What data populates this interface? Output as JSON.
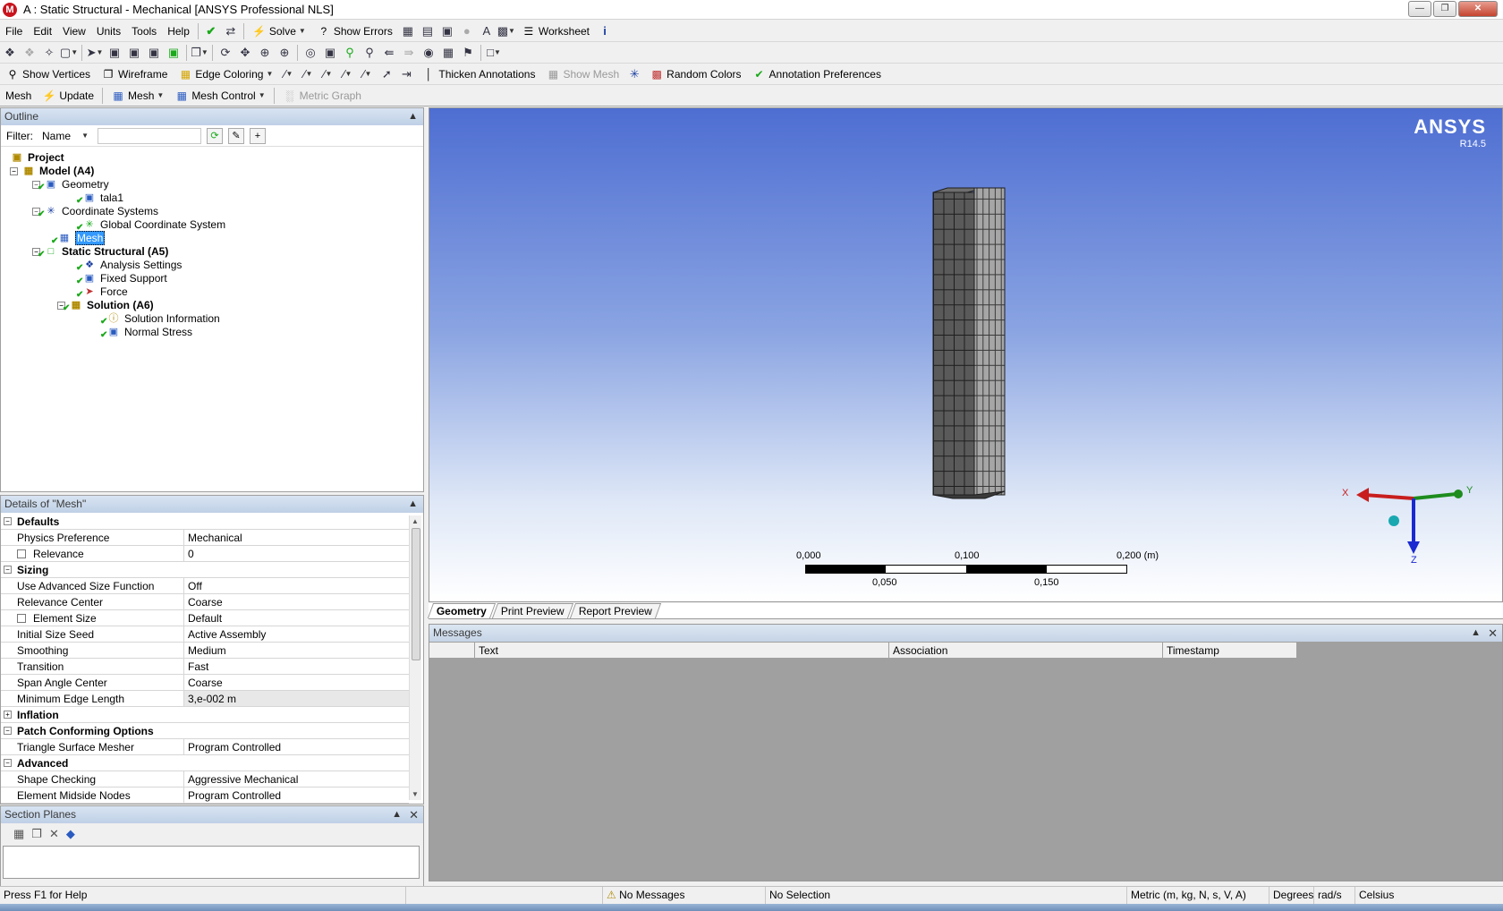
{
  "window": {
    "title": "A : Static Structural - Mechanical [ANSYS Professional NLS]",
    "app_icon_letter": "M"
  },
  "menubar": {
    "menus": [
      "File",
      "Edit",
      "View",
      "Units",
      "Tools",
      "Help"
    ],
    "solve_label": "Solve",
    "show_errors_label": "Show Errors",
    "worksheet_label": "Worksheet"
  },
  "toolbar3": {
    "show_vertices": "Show Vertices",
    "wireframe": "Wireframe",
    "edge_coloring": "Edge Coloring",
    "thicken_annotations": "Thicken Annotations",
    "show_mesh": "Show Mesh",
    "random_colors": "Random Colors",
    "annotation_preferences": "Annotation Preferences"
  },
  "toolbar4": {
    "context_label": "Mesh",
    "update": "Update",
    "mesh": "Mesh",
    "mesh_control": "Mesh Control",
    "metric_graph": "Metric Graph"
  },
  "outline": {
    "header": "Outline",
    "filter_label": "Filter:",
    "filter_value": "Name",
    "tree": [
      {
        "label": "Project",
        "bold": true
      },
      {
        "label": "Model (A4)",
        "bold": true
      },
      {
        "label": "Geometry",
        "bold": false
      },
      {
        "label": "tala1",
        "bold": false
      },
      {
        "label": "Coordinate Systems",
        "bold": false
      },
      {
        "label": "Global Coordinate System",
        "bold": false
      },
      {
        "label": "Mesh",
        "bold": false
      },
      {
        "label": "Static Structural (A5)",
        "bold": true
      },
      {
        "label": "Analysis Settings",
        "bold": false
      },
      {
        "label": "Fixed Support",
        "bold": false
      },
      {
        "label": "Force",
        "bold": false
      },
      {
        "label": "Solution (A6)",
        "bold": true
      },
      {
        "label": "Solution Information",
        "bold": false
      },
      {
        "label": "Normal Stress",
        "bold": false
      }
    ]
  },
  "details": {
    "header": "Details of \"Mesh\"",
    "rows": [
      {
        "type": "group",
        "label": "Defaults",
        "exp": "-"
      },
      {
        "label": "Physics Preference",
        "value": "Mechanical"
      },
      {
        "label": "Relevance",
        "value": "0",
        "checkbox": true
      },
      {
        "type": "group",
        "label": "Sizing",
        "exp": "-"
      },
      {
        "label": "Use Advanced Size Function",
        "value": "Off"
      },
      {
        "label": "Relevance Center",
        "value": "Coarse"
      },
      {
        "label": "Element Size",
        "value": "Default",
        "checkbox": true
      },
      {
        "label": "Initial Size Seed",
        "value": "Active Assembly"
      },
      {
        "label": "Smoothing",
        "value": "Medium"
      },
      {
        "label": "Transition",
        "value": "Fast"
      },
      {
        "label": "Span Angle Center",
        "value": "Coarse"
      },
      {
        "label": "Minimum Edge Length",
        "value": "3,e-002 m",
        "highlight": true
      },
      {
        "type": "group",
        "label": "Inflation",
        "exp": "+"
      },
      {
        "type": "group",
        "label": "Patch Conforming Options",
        "exp": "-"
      },
      {
        "label": "Triangle Surface Mesher",
        "value": "Program Controlled"
      },
      {
        "type": "group",
        "label": "Advanced",
        "exp": "-"
      },
      {
        "label": "Shape Checking",
        "value": "Aggressive Mechanical"
      },
      {
        "label": "Element Midside Nodes",
        "value": "Program Controlled"
      }
    ]
  },
  "section_planes": {
    "header": "Section Planes"
  },
  "graphics": {
    "brand": "ANSYS",
    "version": "R14.5",
    "scale_top": [
      "0,000",
      "0,100",
      "0,200 (m)"
    ],
    "scale_bottom": [
      "0,050",
      "0,150"
    ],
    "axes": {
      "x": "X",
      "y": "Y",
      "z": "Z"
    },
    "colors": {
      "x_axis": "#c81e1e",
      "y_axis": "#1e8c1e",
      "z_axis": "#1a2ad0"
    }
  },
  "view_tabs": [
    "Geometry",
    "Print Preview",
    "Report Preview"
  ],
  "messages": {
    "header": "Messages",
    "columns": [
      "",
      "Text",
      "Association",
      "Timestamp"
    ]
  },
  "status": {
    "help": "Press F1 for Help",
    "messages": "No Messages",
    "selection": "No Selection",
    "units": "Metric (m, kg, N, s, V, A)",
    "angle": "Degrees",
    "rate": "rad/s",
    "temp": "Celsius"
  }
}
